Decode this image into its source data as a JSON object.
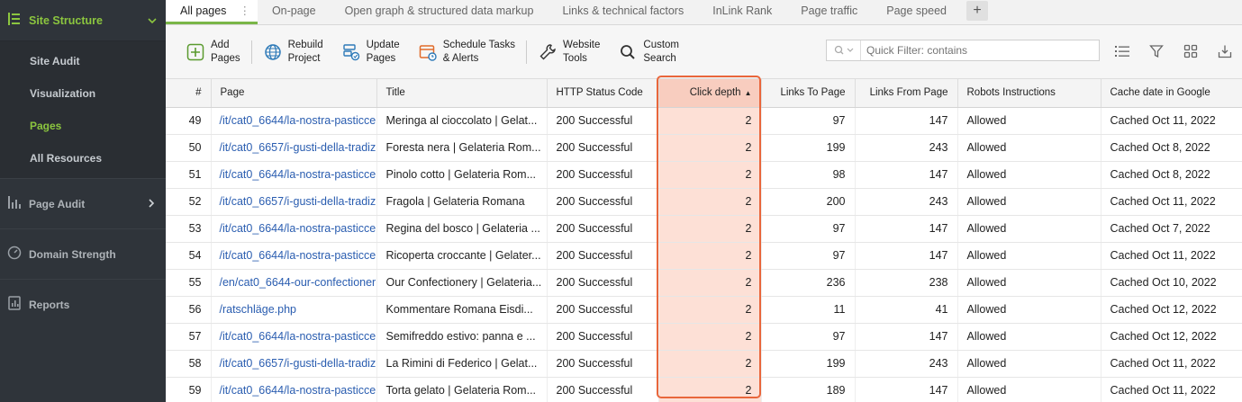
{
  "sidebar": {
    "header": "Site Structure",
    "sub_items": [
      "Site Audit",
      "Visualization",
      "Pages",
      "All Resources"
    ],
    "active_sub": "Pages",
    "sections": [
      "Page Audit",
      "Domain Strength",
      "Reports"
    ]
  },
  "tabs": [
    "All pages",
    "On-page",
    "Open graph & structured data markup",
    "Links & technical factors",
    "InLink Rank",
    "Page traffic",
    "Page speed"
  ],
  "toolbar": {
    "add": "Add\nPages",
    "rebuild": "Rebuild\nProject",
    "update": "Update\nPages",
    "schedule": "Schedule Tasks\n& Alerts",
    "website_tools": "Website\nTools",
    "custom_search": "Custom\nSearch",
    "quick_filter_placeholder": "Quick Filter: contains"
  },
  "table": {
    "columns": [
      "#",
      "Page",
      "Title",
      "HTTP Status Code",
      "Click depth",
      "Links To Page",
      "Links From Page",
      "Robots Instructions",
      "Cache date in Google"
    ],
    "rows": [
      {
        "n": "49",
        "page": "/it/cat0_6644/la-nostra-pasticce",
        "title": "Meringa al cioccolato | Gelat...",
        "status": "200 Successful",
        "depth": "2",
        "to": "97",
        "from": "147",
        "robots": "Allowed",
        "cache": "Cached Oct 11, 2022"
      },
      {
        "n": "50",
        "page": "/it/cat0_6657/i-gusti-della-tradiz",
        "title": "Foresta nera | Gelateria Rom...",
        "status": "200 Successful",
        "depth": "2",
        "to": "199",
        "from": "243",
        "robots": "Allowed",
        "cache": "Cached Oct 8, 2022"
      },
      {
        "n": "51",
        "page": "/it/cat0_6644/la-nostra-pasticce",
        "title": "Pinolo cotto | Gelateria Rom...",
        "status": "200 Successful",
        "depth": "2",
        "to": "98",
        "from": "147",
        "robots": "Allowed",
        "cache": "Cached Oct 8, 2022"
      },
      {
        "n": "52",
        "page": "/it/cat0_6657/i-gusti-della-tradiz",
        "title": "Fragola | Gelateria Romana",
        "status": "200 Successful",
        "depth": "2",
        "to": "200",
        "from": "243",
        "robots": "Allowed",
        "cache": "Cached Oct 11, 2022"
      },
      {
        "n": "53",
        "page": "/it/cat0_6644/la-nostra-pasticce",
        "title": "Regina del bosco | Gelateria ...",
        "status": "200 Successful",
        "depth": "2",
        "to": "97",
        "from": "147",
        "robots": "Allowed",
        "cache": "Cached Oct 7, 2022"
      },
      {
        "n": "54",
        "page": "/it/cat0_6644/la-nostra-pasticce",
        "title": "Ricoperta croccante | Gelater...",
        "status": "200 Successful",
        "depth": "2",
        "to": "97",
        "from": "147",
        "robots": "Allowed",
        "cache": "Cached Oct 11, 2022"
      },
      {
        "n": "55",
        "page": "/en/cat0_6644-our-confectioner",
        "title": "Our Confectionery | Gelateria...",
        "status": "200 Successful",
        "depth": "2",
        "to": "236",
        "from": "238",
        "robots": "Allowed",
        "cache": "Cached Oct 10, 2022"
      },
      {
        "n": "56",
        "page": "/ratschläge.php",
        "title": "Kommentare Romana Eisdi...",
        "status": "200 Successful",
        "depth": "2",
        "to": "11",
        "from": "41",
        "robots": "Allowed",
        "cache": "Cached Oct 12, 2022"
      },
      {
        "n": "57",
        "page": "/it/cat0_6644/la-nostra-pasticce",
        "title": "Semifreddo estivo: panna e ...",
        "status": "200 Successful",
        "depth": "2",
        "to": "97",
        "from": "147",
        "robots": "Allowed",
        "cache": "Cached Oct 12, 2022"
      },
      {
        "n": "58",
        "page": "/it/cat0_6657/i-gusti-della-tradiz",
        "title": "La Rimini di Federico | Gelat...",
        "status": "200 Successful",
        "depth": "2",
        "to": "199",
        "from": "243",
        "robots": "Allowed",
        "cache": "Cached Oct 11, 2022"
      },
      {
        "n": "59",
        "page": "/it/cat0_6644/la-nostra-pasticce",
        "title": "Torta gelato | Gelateria Rom...",
        "status": "200 Successful",
        "depth": "2",
        "to": "189",
        "from": "147",
        "robots": "Allowed",
        "cache": "Cached Oct 11, 2022"
      }
    ]
  },
  "colors": {
    "accent_green": "#8cc63f",
    "highlight": "#e9663b",
    "link": "#2a5db0"
  }
}
